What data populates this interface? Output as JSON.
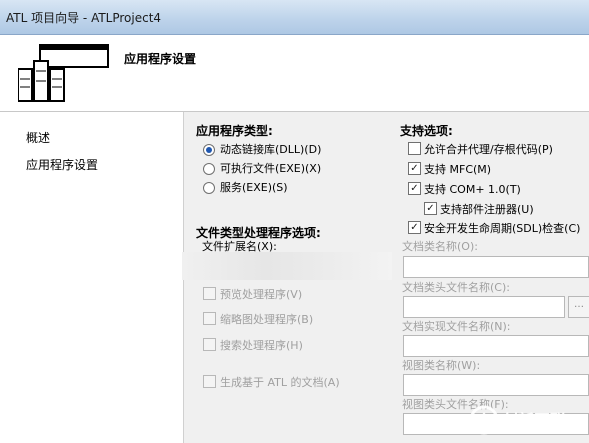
{
  "window": {
    "title": "ATL 项目向导 - ATLProject4"
  },
  "banner": {
    "heading": "应用程序设置",
    "icon": "project-wizard-icon"
  },
  "nav": [
    {
      "label": "概述"
    },
    {
      "label": "应用程序设置"
    }
  ],
  "app_type": {
    "heading": "应用程序类型:",
    "options": [
      {
        "label": "动态链接库(DLL)(D)",
        "selected": true
      },
      {
        "label": "可执行文件(EXE)(X)",
        "selected": false
      },
      {
        "label": "服务(EXE)(S)",
        "selected": false
      }
    ]
  },
  "support": {
    "heading": "支持选项:",
    "options": [
      {
        "label": "允许合并代理/存根代码(P)",
        "checked": false
      },
      {
        "label": "支持 MFC(M)",
        "checked": true
      },
      {
        "label": "支持 COM+ 1.0(T)",
        "checked": true
      },
      {
        "label": "支持部件注册器(U)",
        "checked": true
      },
      {
        "label": "安全开发生命周期(SDL)检查(C)",
        "checked": true
      }
    ]
  },
  "handlers": {
    "heading": "文件类型处理程序选项:",
    "ext_label": "文件扩展名(X):",
    "options": [
      {
        "label": "预览处理程序(V)"
      },
      {
        "label": "缩略图处理程序(B)"
      },
      {
        "label": "搜索处理程序(H)"
      },
      {
        "label": "生成基于 ATL 的文档(A)"
      }
    ]
  },
  "fields": {
    "doc_class": "文档类名称(O):",
    "doc_header": "文档类头文件名称(C):",
    "doc_impl": "文档实现文件名称(N):",
    "view_class": "视图类名称(W):",
    "view_header": "视图类头文件名称(F):"
  },
  "watermark": "创新互联"
}
